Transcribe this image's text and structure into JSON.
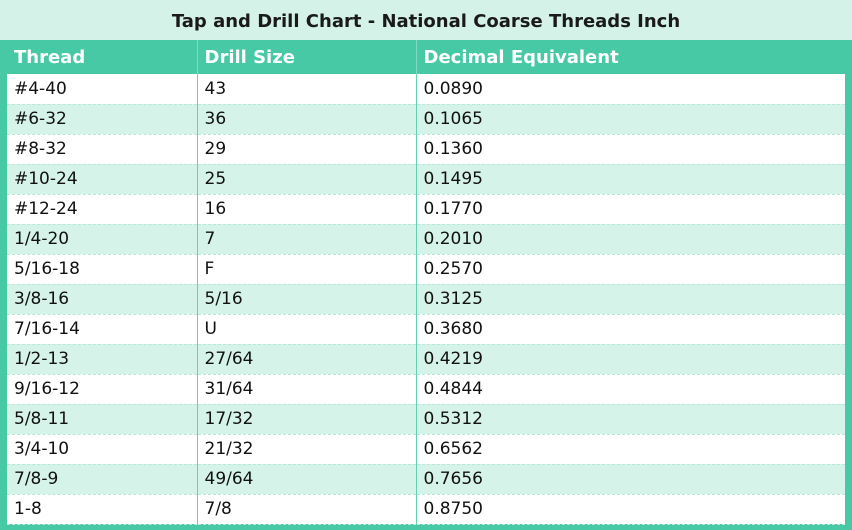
{
  "title": "Tap and Drill Chart - National Coarse Threads Inch",
  "columns": [
    "Thread",
    "Drill Size",
    "Decimal Equivalent"
  ],
  "rows": [
    [
      "#4-40",
      "43",
      "0.0890"
    ],
    [
      "#6-32",
      "36",
      "0.1065"
    ],
    [
      "#8-32",
      "29",
      "0.1360"
    ],
    [
      "#10-24",
      "25",
      "0.1495"
    ],
    [
      "#12-24",
      "16",
      "0.1770"
    ],
    [
      "1/4-20",
      "7",
      "0.2010"
    ],
    [
      "5/16-18",
      "F",
      "0.2570"
    ],
    [
      "3/8-16",
      "5/16",
      "0.3125"
    ],
    [
      "7/16-14",
      "U",
      "0.3680"
    ],
    [
      "1/2-13",
      "27/64",
      "0.4219"
    ],
    [
      "9/16-12",
      "31/64",
      "0.4844"
    ],
    [
      "5/8-11",
      "17/32",
      "0.5312"
    ],
    [
      "3/4-10",
      "21/32",
      "0.6562"
    ],
    [
      "7/8-9",
      "49/64",
      "0.7656"
    ],
    [
      "1-8",
      "7/8",
      "0.8750"
    ]
  ],
  "colors": {
    "header_bg": "#48c9a6",
    "title_bg": "#d4f2e8",
    "row_odd": "#ffffff",
    "row_even": "#d6f3ea"
  }
}
